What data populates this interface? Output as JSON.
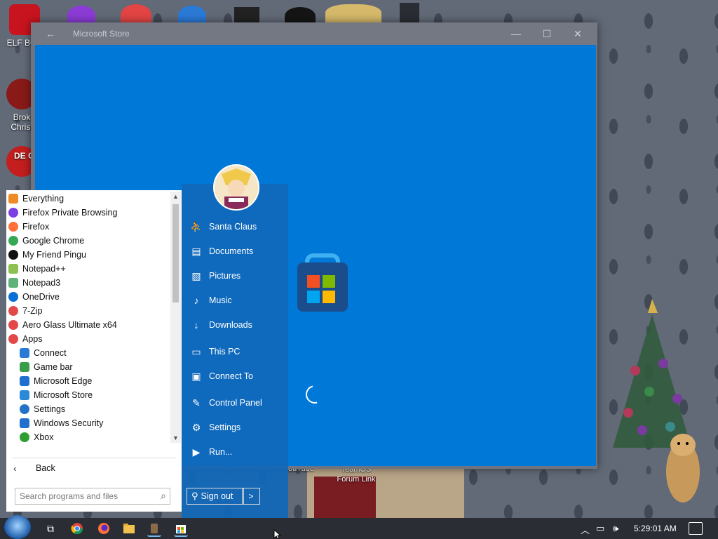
{
  "desktop": {
    "icons": [
      {
        "label": "ELF BOV"
      },
      {
        "label": "Brok"
      },
      {
        "label": "Christ"
      },
      {
        "label": "DE C+"
      }
    ],
    "wallpaper_labels": {
      "youtube": "ouTube",
      "teamos": "TeamOS Forum Link"
    }
  },
  "store_window": {
    "title": "Microsoft Store",
    "back_icon": "back-arrow-icon",
    "minimize": "—",
    "maximize": "☐",
    "close": "✕",
    "background_color": "#0078d7",
    "state": "loading"
  },
  "start_menu": {
    "programs": [
      {
        "label": "Everything",
        "icon": "magnifier-icon",
        "color": "#f08a24",
        "sub": false
      },
      {
        "label": "Firefox Private Browsing",
        "icon": "firefox-private-icon",
        "color": "#7b3fe4",
        "sub": false
      },
      {
        "label": "Firefox",
        "icon": "firefox-icon",
        "color": "#ff7139",
        "sub": false
      },
      {
        "label": "Google Chrome",
        "icon": "chrome-icon",
        "color": "#34a853",
        "sub": false
      },
      {
        "label": "My Friend Pingu",
        "icon": "pingu-icon",
        "color": "#111111",
        "sub": false
      },
      {
        "label": "Notepad++",
        "icon": "notepadpp-icon",
        "color": "#8cc152",
        "sub": false
      },
      {
        "label": "Notepad3",
        "icon": "notepad3-icon",
        "color": "#5fb37a",
        "sub": false
      },
      {
        "label": "OneDrive",
        "icon": "onedrive-icon",
        "color": "#0a6fd6",
        "sub": false
      },
      {
        "label": "7-Zip",
        "icon": "folder-clock-icon",
        "color": "#e24a4a",
        "sub": false
      },
      {
        "label": "Aero Glass Ultimate x64",
        "icon": "folder-clock-icon",
        "color": "#e24a4a",
        "sub": false
      },
      {
        "label": "Apps",
        "icon": "folder-clock-icon",
        "color": "#e24a4a",
        "sub": false
      },
      {
        "label": "Connect",
        "icon": "connect-icon",
        "color": "#2b7bd6",
        "sub": true
      },
      {
        "label": "Game bar",
        "icon": "gamebar-icon",
        "color": "#3a9d4a",
        "sub": true
      },
      {
        "label": "Microsoft Edge",
        "icon": "edge-icon",
        "color": "#1f6fcf",
        "sub": true
      },
      {
        "label": "Microsoft Store",
        "icon": "store-icon",
        "color": "#2a8ad8",
        "sub": true
      },
      {
        "label": "Settings",
        "icon": "gear-icon",
        "color": "#2472c8",
        "sub": true
      },
      {
        "label": "Windows Security",
        "icon": "shield-icon",
        "color": "#1f6fcf",
        "sub": true
      },
      {
        "label": "Xbox",
        "icon": "xbox-icon",
        "color": "#2f9e2f",
        "sub": true
      }
    ],
    "back_label": "Back",
    "search_placeholder": "Search programs and files",
    "user_name": "Santa Claus",
    "right_items": [
      {
        "label": "Santa Claus",
        "icon": "user-folder-icon",
        "glyph": "⛹"
      },
      {
        "label": "Documents",
        "icon": "document-icon",
        "glyph": "▤"
      },
      {
        "label": "Pictures",
        "icon": "picture-icon",
        "glyph": "▨"
      },
      {
        "label": "Music",
        "icon": "music-note-icon",
        "glyph": "♪"
      },
      {
        "label": "Downloads",
        "icon": "download-icon",
        "glyph": "↓"
      },
      {
        "label": "This PC",
        "icon": "computer-icon",
        "glyph": "▭"
      },
      {
        "label": "Connect To",
        "icon": "connect-monitor-icon",
        "glyph": "▣"
      },
      {
        "label": "Control Panel",
        "icon": "wrench-icon",
        "glyph": "✎"
      },
      {
        "label": "Settings",
        "icon": "gear-icon",
        "glyph": "⚙"
      },
      {
        "label": "Run...",
        "icon": "run-icon",
        "glyph": "▶"
      }
    ],
    "sign_out_label": "Sign out",
    "sign_out_arrow": ">"
  },
  "taskbar": {
    "icons": [
      "task-view-icon",
      "chrome-icon",
      "firefox-icon",
      "file-explorer-icon",
      "app-icon",
      "store-icon"
    ],
    "tray_icons": [
      "chevron-up-icon",
      "network-icon",
      "volume-icon"
    ],
    "clock": "5:29:01 AM",
    "notification_icon": "action-center-icon"
  }
}
